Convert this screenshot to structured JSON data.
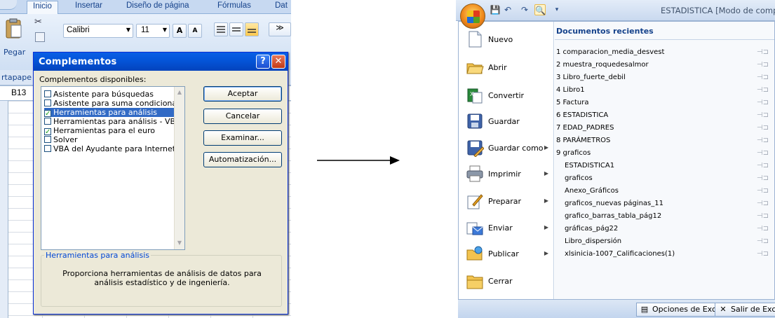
{
  "excel": {
    "tabs": [
      "Inicio",
      "Insertar",
      "Diseño de página",
      "Fórmulas",
      "Dat"
    ],
    "paste_label": "Pegar",
    "clipboard_label": "rtapape",
    "font_name": "Calibri",
    "font_size": "11",
    "grow_font": "A",
    "shrink_font": "A",
    "name_box": "B13"
  },
  "dialog": {
    "title": "Complementos",
    "help_glyph": "?",
    "close_glyph": "✕",
    "available_label": "Complementos disponibles:",
    "items": [
      {
        "label": "Asistente para búsquedas",
        "checked": false,
        "selected": false
      },
      {
        "label": "Asistente para suma condicional",
        "checked": false,
        "selected": false
      },
      {
        "label": "Herramientas para análisis",
        "checked": true,
        "selected": true
      },
      {
        "label": "Herramientas para análisis - VBA",
        "checked": false,
        "selected": false
      },
      {
        "label": "Herramientas para el euro",
        "checked": true,
        "selected": false
      },
      {
        "label": "Solver",
        "checked": false,
        "selected": false
      },
      {
        "label": "VBA del Ayudante para Internet",
        "checked": false,
        "selected": false
      }
    ],
    "buttons": {
      "accept": "Aceptar",
      "cancel": "Cancelar",
      "browse": "Examinar...",
      "automation": "Automatización..."
    },
    "description_title": "Herramientas para análisis",
    "description_text": "Proporciona herramientas de análisis de datos para análisis estadístico y de ingeniería."
  },
  "office": {
    "window_title": "ESTADISTICA  [Modo de comp",
    "menu_items": [
      {
        "label": "Nuevo",
        "icon": "new-document-icon",
        "submenu": false
      },
      {
        "label": "Abrir",
        "icon": "open-folder-icon",
        "submenu": false
      },
      {
        "label": "Convertir",
        "icon": "convert-icon",
        "submenu": false
      },
      {
        "label": "Guardar",
        "icon": "save-icon",
        "submenu": false
      },
      {
        "label": "Guardar como",
        "icon": "save-as-icon",
        "submenu": true
      },
      {
        "label": "Imprimir",
        "icon": "printer-icon",
        "submenu": true
      },
      {
        "label": "Preparar",
        "icon": "prepare-icon",
        "submenu": true
      },
      {
        "label": "Enviar",
        "icon": "send-icon",
        "submenu": true
      },
      {
        "label": "Publicar",
        "icon": "publish-icon",
        "submenu": true
      },
      {
        "label": "Cerrar",
        "icon": "close-folder-icon",
        "submenu": false
      }
    ],
    "recent_header": "Documentos recientes",
    "recent_docs": [
      "1  comparacion_media_desvest",
      "2  muestra_roquedesalmor",
      "3  Libro_fuerte_debil",
      "4  Libro1",
      "5  Factura",
      "6  ESTADISTICA",
      "7  EDAD_PADRES",
      "8  PARÁMETROS",
      "9  graficos",
      "ESTADISTICA1",
      "graficos",
      "Anexo_Gráficos",
      "graficos_nuevas páginas_11",
      "grafico_barras_tabla_pág12",
      "gráficas_pág22",
      "Libro_dispersión",
      "xlsinicia-1007_Calificaciones(1)"
    ],
    "options_button": "Opciones de Excel",
    "exit_button": "Salir de Excel"
  }
}
